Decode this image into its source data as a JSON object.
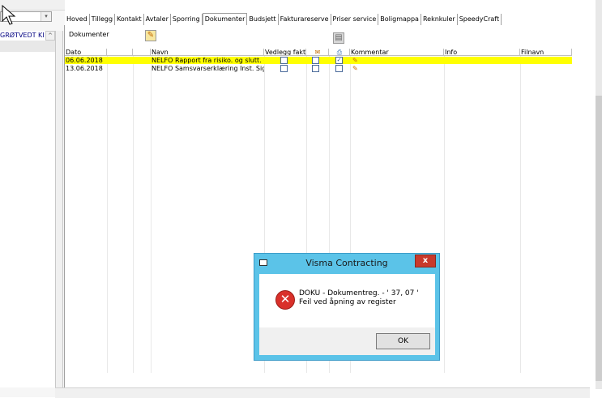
{
  "left_pane": {
    "combo_arrow": "▾",
    "scroll_up_arrow": "^",
    "items": [
      "GRØTVEDT KI",
      ""
    ]
  },
  "tabs": [
    {
      "label": "Hoved"
    },
    {
      "label": "Tillegg"
    },
    {
      "label": "Kontakt"
    },
    {
      "label": "Avtaler"
    },
    {
      "label": "Sporring"
    },
    {
      "label": "Dokumenter",
      "active": true
    },
    {
      "label": "Budsjett"
    },
    {
      "label": "Fakturareserve"
    },
    {
      "label": "Priser service"
    },
    {
      "label": "Boligmappa"
    },
    {
      "label": "Reknkuler"
    },
    {
      "label": "SpeedyCraft"
    }
  ],
  "documents": {
    "section_label": "Dokumenter",
    "columns": {
      "dato": "Dato",
      "navn": "Navn",
      "vedlegg": "Vedlegg fakt.",
      "kommentar": "Kommentar",
      "info": "Info",
      "filnavn": "Filnavn"
    },
    "rows": [
      {
        "dato": "06.06.2018",
        "navn": "NELFO Rapport fra risiko. og slutt. (M",
        "vedlegg": false,
        "col_a": false,
        "col_b": true,
        "selected": true
      },
      {
        "dato": "13.06.2018",
        "navn": "NELFO Samsvarserklæring Inst. Sign",
        "vedlegg": false,
        "col_a": false,
        "col_b": false,
        "selected": false
      }
    ]
  },
  "dialog": {
    "title": "Visma Contracting",
    "close_label": "x",
    "error_glyph": "✕",
    "message_line1": "DOKU - Dokumentreg. -  ' 37, 07 '",
    "message_line2": "Feil ved åpning av register",
    "ok_label": "OK"
  },
  "colors": {
    "selected_row": "#ffff00",
    "dialog_frame": "#5bc3e8",
    "close_button": "#c9392b",
    "error_icon": "#d9302a"
  }
}
